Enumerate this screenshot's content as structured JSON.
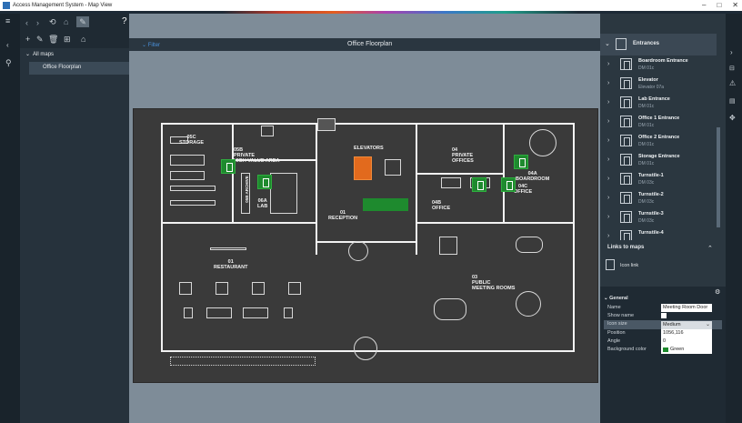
{
  "window": {
    "title": "Access Management System - Map View",
    "minimize": "–",
    "maximize": "□",
    "close": "✕"
  },
  "toolbar": {
    "help": "?"
  },
  "tree": {
    "root": "All maps",
    "item": "Office Floorplan"
  },
  "map": {
    "title": "Office Floorplan",
    "filter": "Filter"
  },
  "floorplan": {
    "rooms": {
      "storage": "05C\nSTORAGE",
      "private_high_value": "05B\nPRIVATE\nHIGH VALUE AREA",
      "archive": "05B ARCHIVE",
      "lab": "06A\nLAB",
      "elevators": "ELEVATORS",
      "reception": "01\nRECEPTION",
      "private_offices": "04\nPRIVATE\nOFFICES",
      "boardroom": "04A\nBOARDROOM",
      "office_c": "04C\nOFFICE",
      "office_b": "04B\nOFFICE",
      "restaurant": "01\nRESTAURANT",
      "public_meeting": "03\nPUBLIC\nMEETING ROOMS"
    }
  },
  "entrances": {
    "header": "Entrances",
    "items": [
      {
        "name": "Boardroom Entrance",
        "sub": "DM 01c"
      },
      {
        "name": "Elevator",
        "sub": "Elevator 07a"
      },
      {
        "name": "Lab Entrance",
        "sub": "DM 01c"
      },
      {
        "name": "Office 1 Entrance",
        "sub": "DM 01c"
      },
      {
        "name": "Office 2 Entrance",
        "sub": "DM 01c"
      },
      {
        "name": "Storage Entrance",
        "sub": "DM 01c"
      },
      {
        "name": "Turnstile-1",
        "sub": "DM 03c"
      },
      {
        "name": "Turnstile-2",
        "sub": "DM 03c"
      },
      {
        "name": "Turnstile-3",
        "sub": "DM 03c"
      },
      {
        "name": "Turnstile-4",
        "sub": ""
      }
    ]
  },
  "links": {
    "header": "Links to maps",
    "icon_link": "Icon link"
  },
  "properties": {
    "section": "General",
    "rows": [
      {
        "label": "Name",
        "value": "Meeting Room Door"
      },
      {
        "label": "Show name",
        "value": ""
      },
      {
        "label": "Icon size",
        "value": "Medium"
      },
      {
        "label": "Position",
        "value": "1056,116"
      },
      {
        "label": "Angle",
        "value": "0"
      },
      {
        "label": "Background color",
        "value": "Green"
      }
    ],
    "accent_color": "#1e8a2e"
  }
}
